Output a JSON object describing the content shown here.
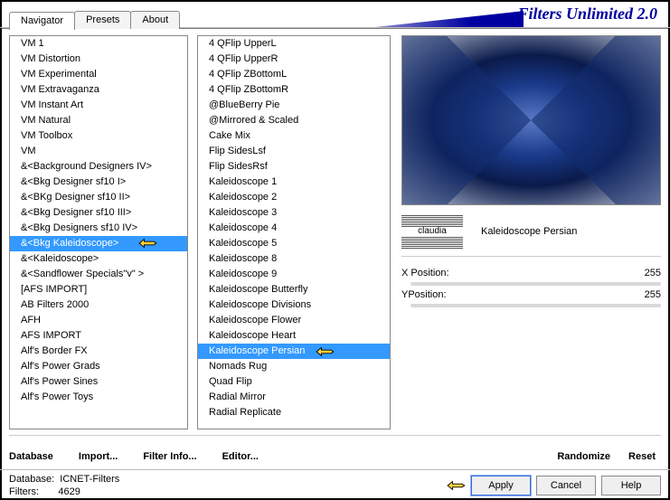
{
  "app_title": "Filters Unlimited 2.0",
  "tabs": [
    "Navigator",
    "Presets",
    "About"
  ],
  "active_tab": 0,
  "left_list": [
    "VM 1",
    "VM Distortion",
    "VM Experimental",
    "VM Extravaganza",
    "VM Instant Art",
    "VM Natural",
    "VM Toolbox",
    "VM",
    "&<Background Designers IV>",
    "&<Bkg Designer sf10 I>",
    "&<BKg Designer sf10 II>",
    "&<Bkg Designer sf10 III>",
    "&<Bkg Designers sf10 IV>",
    "&<Bkg Kaleidoscope>",
    "&<Kaleidoscope>",
    "&<Sandflower Specials\"v\" >",
    "[AFS IMPORT]",
    "AB Filters 2000",
    "AFH",
    "AFS IMPORT",
    "Alf's Border FX",
    "Alf's Power Grads",
    "Alf's Power Sines",
    "Alf's Power Toys"
  ],
  "left_selected": 13,
  "mid_list": [
    "4 QFlip UpperL",
    "4 QFlip UpperR",
    "4 QFlip ZBottomL",
    "4 QFlip ZBottomR",
    "@BlueBerry Pie",
    "@Mirrored & Scaled",
    "Cake Mix",
    "Flip SidesLsf",
    "Flip SidesRsf",
    "Kaleidoscope 1",
    "Kaleidoscope 2",
    "Kaleidoscope 3",
    "Kaleidoscope 4",
    "Kaleidoscope 5",
    "Kaleidoscope 8",
    "Kaleidoscope 9",
    "Kaleidoscope Butterfly",
    "Kaleidoscope Divisions",
    "Kaleidoscope Flower",
    "Kaleidoscope Heart",
    "Kaleidoscope Persian",
    "Nomads Rug",
    "Quad Flip",
    "Radial Mirror",
    "Radial Replicate"
  ],
  "mid_selected": 20,
  "badge": "claudia",
  "filter_name": "Kaleidoscope Persian",
  "params": [
    {
      "label": "X Position:",
      "value": "255"
    },
    {
      "label": "YPosition:",
      "value": "255"
    }
  ],
  "link_buttons": {
    "database": "Database",
    "import": "Import...",
    "filter_info": "Filter Info...",
    "editor": "Editor...",
    "randomize": "Randomize",
    "reset": "Reset"
  },
  "footer": {
    "db_label": "Database:",
    "db_value": "ICNET-Filters",
    "filters_label": "Filters:",
    "filters_value": "4629"
  },
  "buttons": {
    "apply": "Apply",
    "cancel": "Cancel",
    "help": "Help"
  }
}
